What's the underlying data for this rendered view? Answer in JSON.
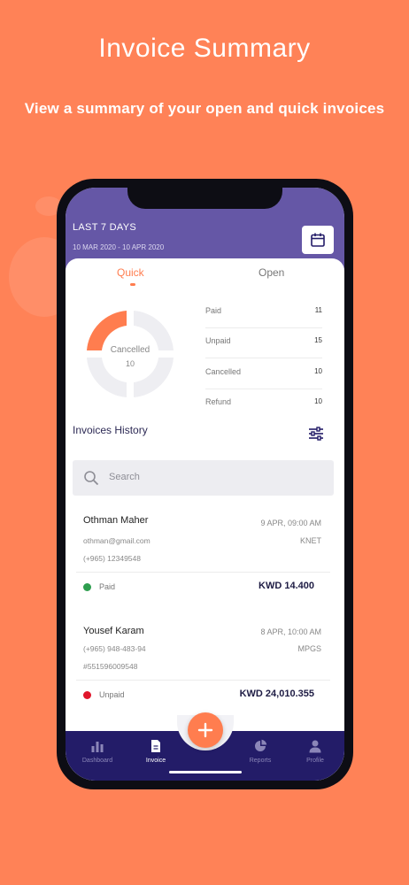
{
  "headline": {
    "title": "Invoice Summary",
    "subtitle": "View a summary of your open and quick invoices"
  },
  "header": {
    "period_label": "LAST 7 DAYS",
    "date_range": "10 MAR 2020 - 10 APR 2020"
  },
  "segments": {
    "quick": "Quick",
    "open": "Open",
    "active": "Quick"
  },
  "donut": {
    "label": "Cancelled",
    "value": "10",
    "accent": "#ff7d4f",
    "track": "#eeeef2"
  },
  "stats": [
    {
      "name": "Paid",
      "value": "11"
    },
    {
      "name": "Unpaid",
      "value": "15"
    },
    {
      "name": "Cancelled",
      "value": "10"
    },
    {
      "name": "Refund",
      "value": "10"
    }
  ],
  "history": {
    "title": "Invoices History",
    "search_placeholder": "Search"
  },
  "invoices": [
    {
      "name": "Othman Maher",
      "date": "9 APR, 09:00 AM",
      "line1": "othman@gmail.com",
      "method": "KNET",
      "line2": "(+965) 12349548",
      "status": "Paid",
      "status_color": "#2e9e4f",
      "amount": "KWD 14.400"
    },
    {
      "name": "Yousef Karam",
      "date": "8 APR, 10:00 AM",
      "line1": "(+965) 948-483-94",
      "method": "MPGS",
      "line2": "#551596009548",
      "status": "Unpaid",
      "status_color": "#e0162b",
      "amount": "KWD 24,010.355"
    }
  ],
  "tabs": [
    {
      "label": "Dashboard"
    },
    {
      "label": "Invoice"
    },
    {
      "label": "Reports"
    },
    {
      "label": "Profile"
    }
  ],
  "colors": {
    "background": "#ff8257",
    "header": "#6557a6",
    "tabbar": "#231c68",
    "accent": "#ff7d4f"
  }
}
